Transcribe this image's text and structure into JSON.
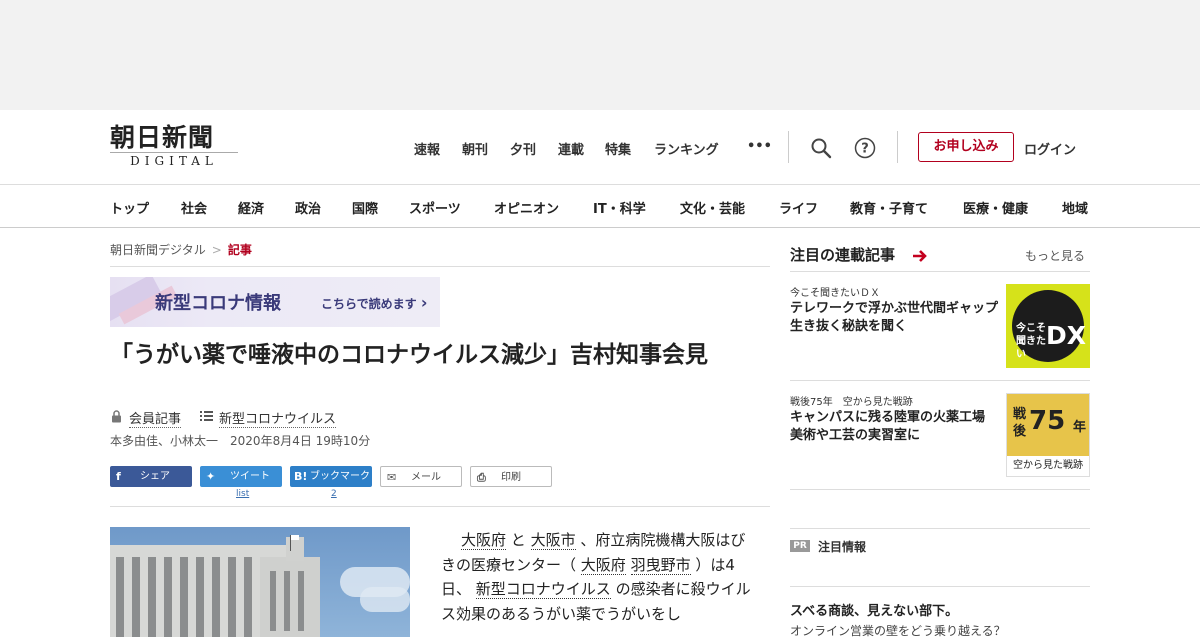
{
  "logo": {
    "main": "朝日新聞",
    "sub": "DIGITAL"
  },
  "topnav": [
    "速報",
    "朝刊",
    "夕刊",
    "連載",
    "特集",
    "ランキング",
    "•••"
  ],
  "header": {
    "apply_label": "お申し込み",
    "login_label": "ログイン"
  },
  "categories": [
    "トップ",
    "社会",
    "経済",
    "政治",
    "国際",
    "スポーツ",
    "オピニオン",
    "IT・科学",
    "文化・芸能",
    "ライフ",
    "教育・子育て",
    "医療・健康",
    "地域"
  ],
  "breadcrumb": {
    "home": "朝日新聞デジタル",
    "sep": ">",
    "current": "記事"
  },
  "banner": {
    "title": "新型コロナ情報",
    "link": "こちらで読めます",
    "chevron": "›"
  },
  "article": {
    "headline": "「うがい薬で唾液中のコロナウイルス減少」吉村知事会見",
    "member_tag": "会員記事",
    "topic_tag": "新型コロナウイルス",
    "authors": "本多由佳、小林太一",
    "date": "2020年8月4日 19時10分",
    "body": {
      "p1": "大阪府",
      "p2": " と ",
      "p3": "大阪市",
      "p4": " 、府立病院機構大阪はびきの医療センター（ ",
      "p5": "大阪府",
      "p6": "  ",
      "p7": "羽曳野市",
      "p8": " ）は4日、 ",
      "p9": "新型コロナウイルス",
      "p10": " の感染者に殺ウイルス効果のあるうがい薬でうがいをし"
    }
  },
  "share": {
    "facebook": "シェア",
    "twitter": "ツイート",
    "hatena": "ブックマーク",
    "mail": "メール",
    "print": "印刷",
    "twitter_count": "list",
    "hatena_count": "2",
    "fb_glyph": "f",
    "tw_glyph": "✦",
    "hb_glyph": "B!",
    "mail_glyph": "✉",
    "print_glyph": "⎙"
  },
  "sidebar": {
    "heading": "注目の連載記事",
    "more": "もっと見る",
    "items": [
      {
        "tag": "今こそ聞きたいＤＸ",
        "title": "テレワークで浮かぶ世代間ギャップ　生き抜く秘訣を聞く",
        "thumb_a": "今こそ聞きたい",
        "thumb_b": "DX"
      },
      {
        "tag": "戦後75年　空から見た戦跡",
        "title": "キャンパスに残る陸軍の火薬工場　美術や工芸の実習室に",
        "thumb_a": "戦後",
        "thumb_b": "75",
        "thumb_c": "年",
        "thumb_d": "空から見た戦跡"
      }
    ],
    "pr_badge": "PR",
    "pr_label": "注目情報",
    "pr_title": "スベる商談、見えない部下。",
    "pr_sub": "オンライン営業の壁をどう乗り越える？"
  }
}
